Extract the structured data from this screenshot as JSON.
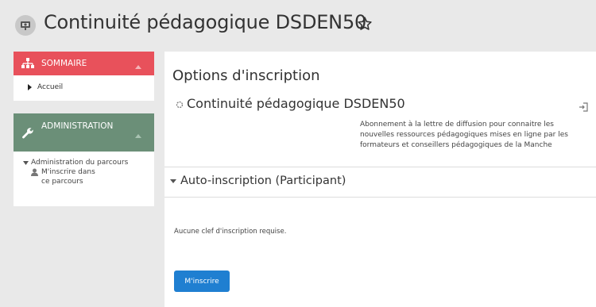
{
  "header": {
    "title": "Continuité pédagogique DSDEN50",
    "course_icon": "course-presentation-icon",
    "favourite_icon": "star-outline-icon"
  },
  "sidebar": {
    "sommaire": {
      "title": "SOMMAIRE",
      "color": "#e8515b",
      "items": [
        {
          "label": "Accueil",
          "icon": "caret-right-icon"
        }
      ]
    },
    "administration": {
      "title": "ADMINISTRATION",
      "color": "#6b8f78",
      "tree": {
        "root_label": "Administration du parcours",
        "children": [
          {
            "label": "M'inscrire dans ce parcours",
            "icon": "user-icon"
          }
        ]
      }
    }
  },
  "main": {
    "heading": "Options d'inscription",
    "course": {
      "name": "Continuité pédagogique DSDEN50",
      "summary": "Abonnement à la lettre de diffusion pour connaitre les nouvelles ressources pédagogiques mises en ligne par les formateurs et conseillers pédagogiques de la Manche"
    },
    "section": {
      "title": "Auto-inscription (Participant)",
      "no_key_text": "Aucune clef d'inscription requise.",
      "enrol_button": "M'inscrire"
    }
  },
  "colors": {
    "primary_button": "#1f7fd1",
    "page_background": "#e9e9e9"
  }
}
